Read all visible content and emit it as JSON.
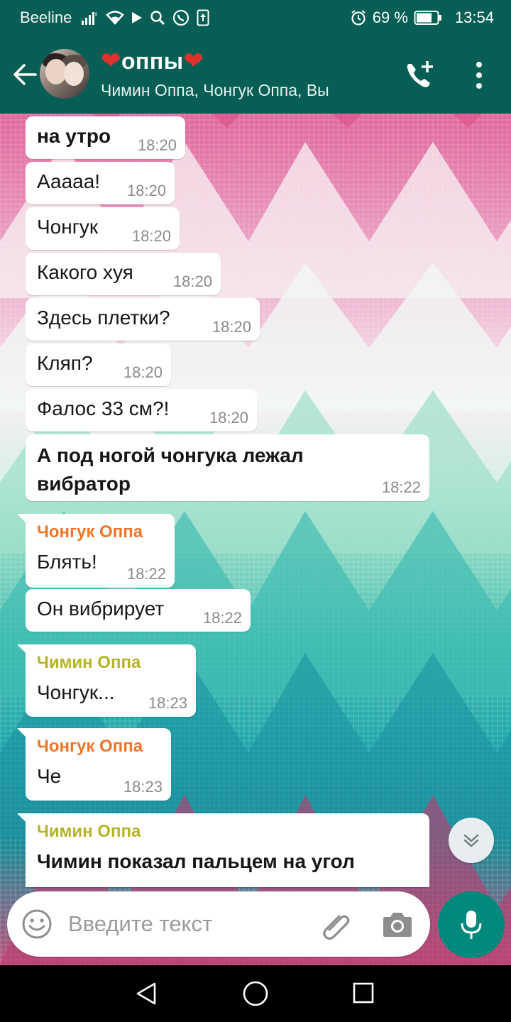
{
  "status_bar": {
    "carrier": "Beeline",
    "battery": "69 %",
    "time": "13:54",
    "icons": [
      "signal-icon",
      "wifi-icon",
      "play-icon",
      "search-icon",
      "whatsapp-icon",
      "upload-icon",
      "alarm-icon",
      "battery-icon"
    ]
  },
  "header": {
    "title": "оппы",
    "title_decoration": "❤",
    "subtitle": "Чимин Оппа, Чонгук Оппа, Вы"
  },
  "colors": {
    "header_bg": "#075e54",
    "accent": "#00897b",
    "jungkook_name": "#f07527",
    "jimin_name": "#b4b427",
    "heart": "#e0332e"
  },
  "messages": [
    {
      "text": "на утро",
      "time": "18:20",
      "bold": true
    },
    {
      "text": "Ааааа!",
      "time": "18:20"
    },
    {
      "text": "Чонгук",
      "time": "18:20"
    },
    {
      "text": "Какого хуя",
      "time": "18:20"
    },
    {
      "text": "Здесь плетки?",
      "time": "18:20"
    },
    {
      "text": "Кляп?",
      "time": "18:20"
    },
    {
      "text": "Фалос 33 см?!",
      "time": "18:20"
    },
    {
      "text": "А под ногой чонгука лежал вибратор",
      "time": "18:22",
      "bold": true
    },
    {
      "sender": "Чонгук Оппа",
      "text": "Блять!",
      "time": "18:22"
    },
    {
      "text": "Он вибрирует",
      "time": "18:22"
    },
    {
      "sender": "Чимин Оппа",
      "text": "Чонгук...",
      "time": "18:23"
    },
    {
      "sender": "Чонгук Оппа",
      "text": "Че",
      "time": "18:23"
    },
    {
      "sender": "Чимин Оппа",
      "text": "Чимин показал пальцем на угол",
      "bold": true
    }
  ],
  "input": {
    "placeholder": "Введите текст"
  }
}
